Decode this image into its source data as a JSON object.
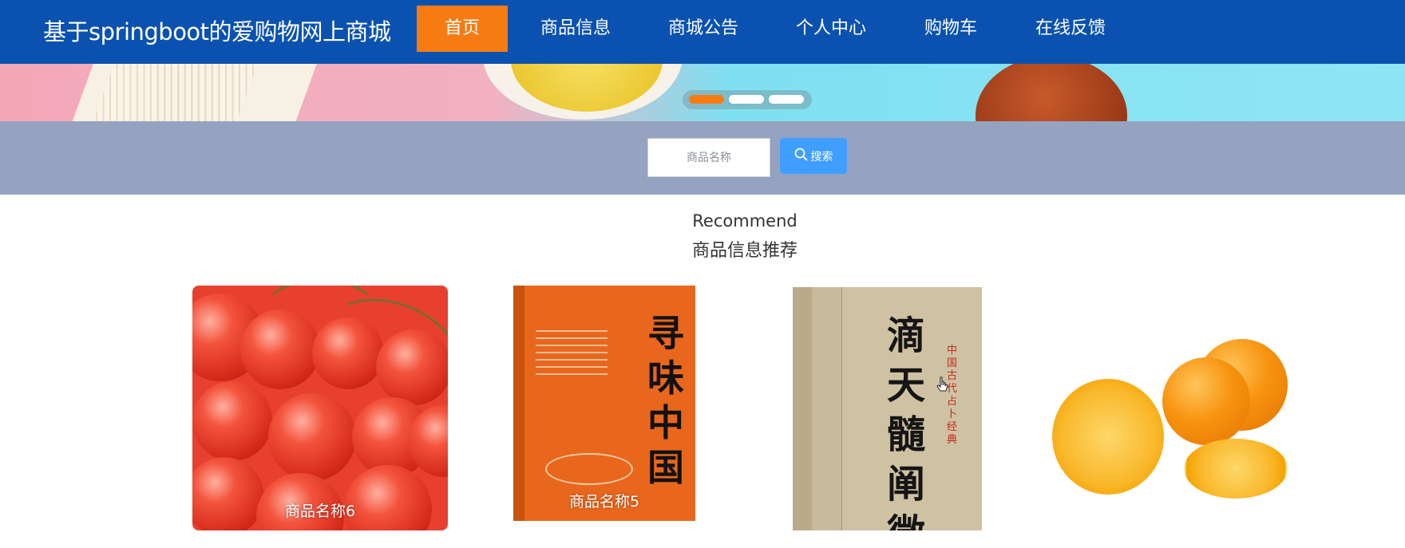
{
  "header": {
    "site_title": "基于springboot的爱购物网上商城",
    "nav": [
      {
        "label": "首页",
        "active": true
      },
      {
        "label": "商品信息",
        "active": false
      },
      {
        "label": "商城公告",
        "active": false
      },
      {
        "label": "个人中心",
        "active": false
      },
      {
        "label": "购物车",
        "active": false
      },
      {
        "label": "在线反馈",
        "active": false
      }
    ]
  },
  "banner": {
    "slide_count": 3,
    "active_slide": 1
  },
  "search": {
    "placeholder": "商品名称",
    "button_label": "搜索",
    "button_icon": "search-icon"
  },
  "recommend": {
    "title_en": "Recommend",
    "title_cn": "商品信息推荐"
  },
  "products": [
    {
      "name": "商品名称6",
      "image": "cherries"
    },
    {
      "name": "商品名称5",
      "image": "book-cover-orange",
      "cover_title": "寻味中国"
    },
    {
      "name": "",
      "image": "book-cover-tan",
      "cover_title": "滴天髓阐微",
      "cover_subtitle": "中国古代占卜经典"
    },
    {
      "name": "",
      "image": "oranges"
    }
  ],
  "colors": {
    "header_bg": "#0b52b0",
    "nav_active": "#f57b12",
    "search_strip": "#95a3c0",
    "search_button": "#409eff"
  }
}
